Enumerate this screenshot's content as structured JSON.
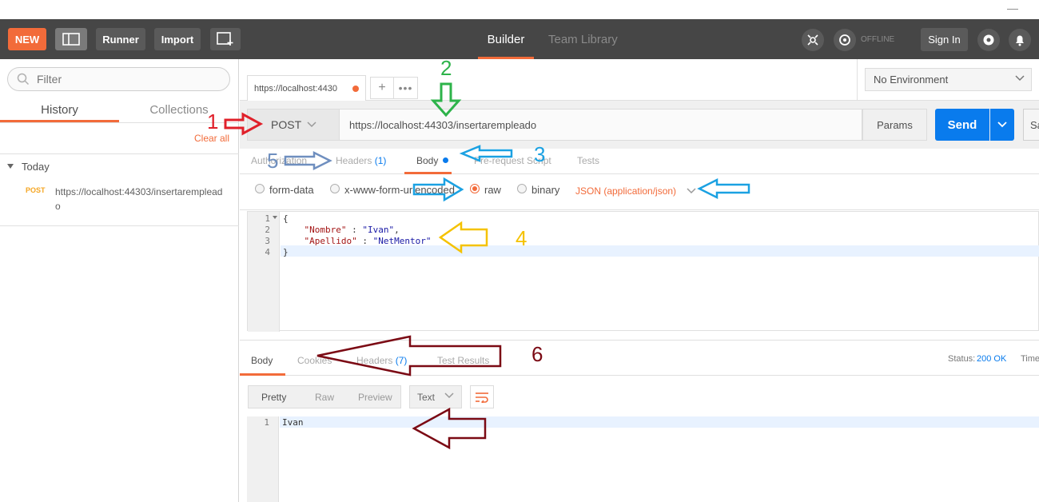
{
  "header": {
    "new_label": "NEW",
    "runner_label": "Runner",
    "import_label": "Import",
    "nav_builder": "Builder",
    "nav_team_library": "Team Library",
    "offline_label": "OFFLINE",
    "signin_label": "Sign In"
  },
  "sidebar": {
    "filter_placeholder": "Filter",
    "tabs": {
      "history": "History",
      "collections": "Collections"
    },
    "clear_all": "Clear all",
    "group_today": "Today",
    "history_items": [
      {
        "method": "POST",
        "url": "https://localhost:44303/insertarempleado"
      }
    ]
  },
  "request_tab": {
    "title": "https://localhost:4430"
  },
  "environment": {
    "selected": "No Environment"
  },
  "request": {
    "method": "POST",
    "url": "https://localhost:44303/insertarempleado",
    "params_label": "Params",
    "send_label": "Send",
    "save_label": "Sa"
  },
  "request_tabs": {
    "authorization": "Authorization",
    "headers": "Headers",
    "headers_count": "(1)",
    "body": "Body",
    "prerequest": "Pre-request Script",
    "tests": "Tests"
  },
  "body_modes": {
    "form_data": "form-data",
    "urlencoded": "x-www-form-urlencoded",
    "raw": "raw",
    "binary": "binary",
    "content_type": "JSON (application/json)"
  },
  "editor": {
    "lines": [
      {
        "n": "1",
        "text": "{"
      },
      {
        "n": "2",
        "key": "\"Nombre\"",
        "sep": " : ",
        "val": "\"Ivan\"",
        "tail": ","
      },
      {
        "n": "3",
        "key": "\"Apellido\"",
        "sep": " : ",
        "val": "\"NetMentor\"",
        "tail": ""
      },
      {
        "n": "4",
        "text": "}"
      }
    ]
  },
  "response_tabs": {
    "body": "Body",
    "cookies": "Cookies",
    "headers": "Headers",
    "headers_count": "(7)",
    "test_results": "Test Results",
    "status_label": "Status:",
    "status_value": "200 OK",
    "time_label": "Time"
  },
  "response_tools": {
    "pretty": "Pretty",
    "raw": "Raw",
    "preview": "Preview",
    "format": "Text"
  },
  "response_body": {
    "lines": [
      {
        "n": "1",
        "text": "Ivan"
      }
    ]
  },
  "annotations": {
    "n1": "1",
    "n2": "2",
    "n3": "3",
    "n4": "4",
    "n5": "5",
    "n6": "6",
    "red": "#e0202a",
    "green": "#2db34a",
    "blue": "#1ba1e2",
    "yellow": "#f5c200",
    "steel": "#6f8fbf",
    "maroon": "#7b0a14"
  },
  "colors": {
    "accent": "#f26b3a",
    "send": "#097bed",
    "header_bg": "#464646"
  }
}
